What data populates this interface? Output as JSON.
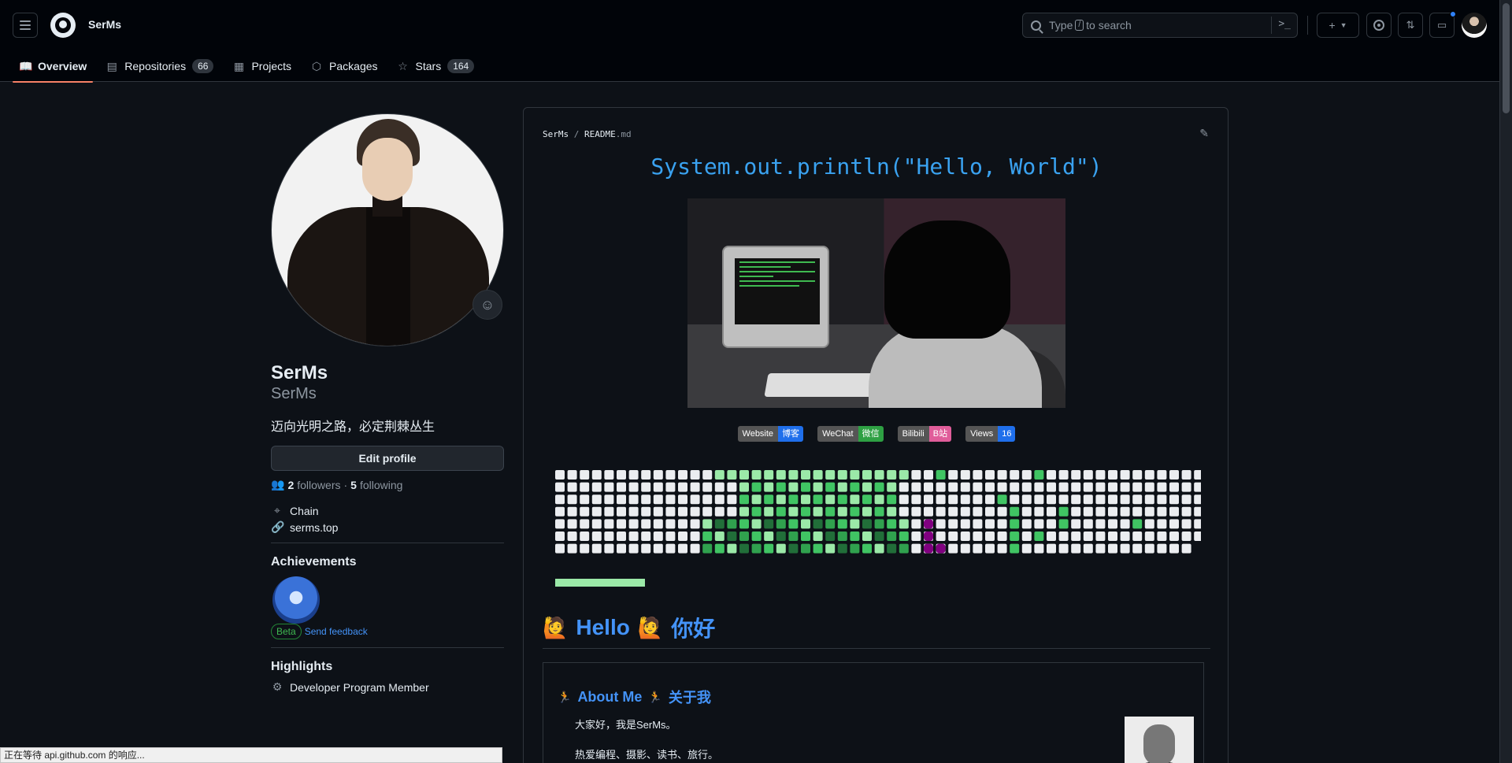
{
  "header": {
    "username": "SerMs",
    "search_prefix": "Type",
    "search_key": "/",
    "search_suffix": "to search",
    "plus_label": "+",
    "cmd_label": ">_"
  },
  "tabs": [
    {
      "label": "Overview",
      "icon": "book-icon",
      "glyph": "📖",
      "active": true
    },
    {
      "label": "Repositories",
      "icon": "repo-icon",
      "glyph": "▤",
      "count": "66"
    },
    {
      "label": "Projects",
      "icon": "table-icon",
      "glyph": "▦"
    },
    {
      "label": "Packages",
      "icon": "package-icon",
      "glyph": "⬡"
    },
    {
      "label": "Stars",
      "icon": "star-icon",
      "glyph": "☆",
      "count": "164"
    }
  ],
  "profile": {
    "name": "SerMs",
    "login": "SerMs",
    "bio": "迈向光明之路，必定荆棘丛生",
    "edit_label": "Edit profile",
    "followers_count": "2",
    "followers_label": "followers",
    "dot": "·",
    "following_count": "5",
    "following_label": "following",
    "location": "Chain",
    "website": "serms.top",
    "achievements_title": "Achievements",
    "beta_label": "Beta",
    "feedback_label": "Send feedback",
    "highlights_title": "Highlights",
    "highlight_item": "Developer Program Member"
  },
  "readme": {
    "path_owner": "SerMs",
    "path_sep": "/",
    "path_file": "README",
    "path_ext": ".md",
    "hello_code": "System.out.println(\"Hello, World\")",
    "badges": [
      {
        "key": "Website",
        "value": "博客",
        "color": "#1f6feb"
      },
      {
        "key": "WeChat",
        "value": "微信",
        "color": "#2ea043"
      },
      {
        "key": "Bilibili",
        "value": "B站",
        "color": "#e05d9a"
      },
      {
        "key": "Views",
        "value": "16",
        "color": "#1f6feb"
      }
    ],
    "progress": 0.3,
    "hello_heading": "Hello",
    "hello_cn": "你好",
    "about_title": "About Me",
    "about_cn": "关于我",
    "about_line1": "大家好，我是SerMs。",
    "about_line2": "热爱编程、摄影、读书、旅行。"
  },
  "status_bar": "正在等待 api.github.com 的响应..."
}
